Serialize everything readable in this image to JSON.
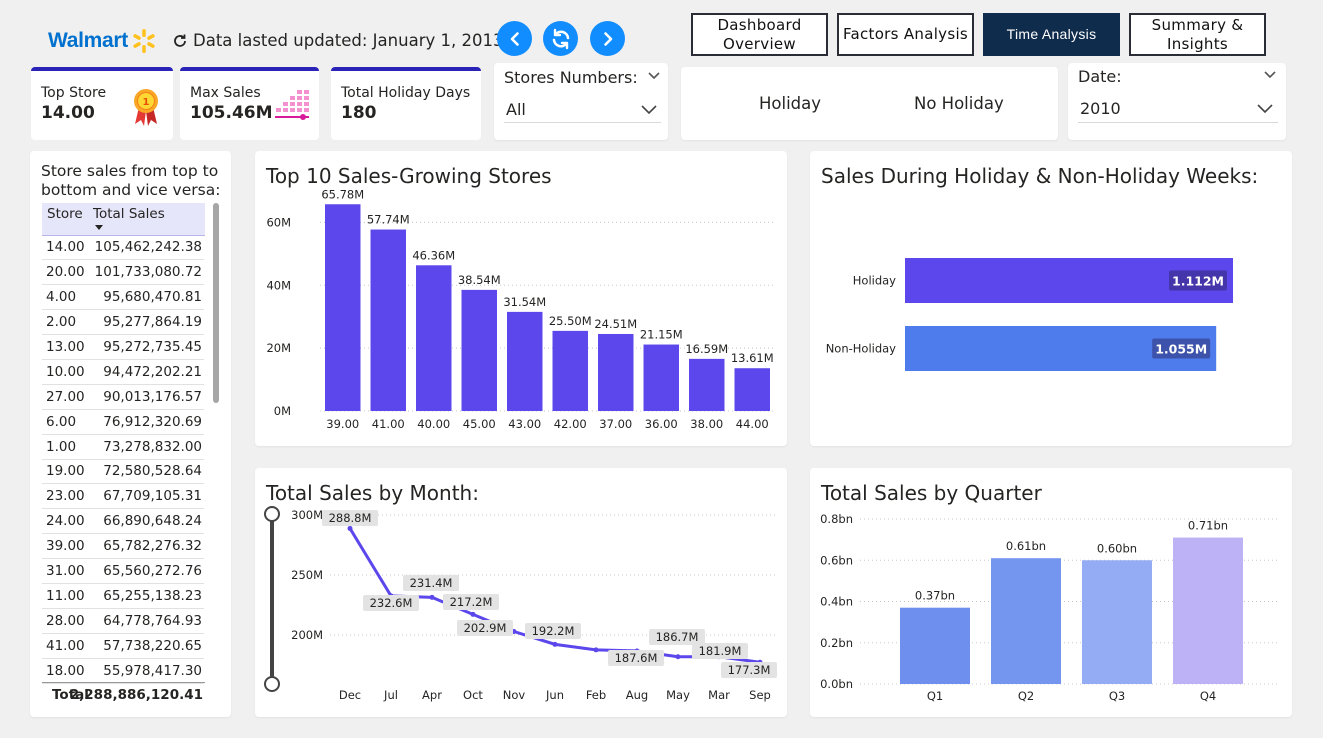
{
  "header": {
    "brand": "Walmart",
    "updated_text": "Data lasted updated: January 1, 2013",
    "tabs": [
      {
        "label_line1": "Dashboard",
        "label_line2": "Overview",
        "active": false
      },
      {
        "label_line1": "Factors Analysis",
        "label_line2": "",
        "active": false
      },
      {
        "label_line1": "Time Analysis",
        "label_line2": "",
        "active": true
      },
      {
        "label_line1": "Summary &",
        "label_line2": "Insights",
        "active": false
      }
    ],
    "icons": [
      "spark-logo-icon",
      "refresh-small-icon",
      "chevron-left-icon",
      "refresh-icon",
      "chevron-right-icon"
    ]
  },
  "kpis": {
    "top_store": {
      "label": "Top Store",
      "value": "14.00",
      "icon": "medal-icon"
    },
    "max_sales": {
      "label": "Max Sales",
      "value": "105.46M",
      "icon": "bar-levels-icon"
    },
    "holiday_days": {
      "label": "Total Holiday Days",
      "value": "180"
    }
  },
  "filters": {
    "stores": {
      "title": "Stores Numbers:",
      "value": "All"
    },
    "holiday_toggle": {
      "option1": "Holiday",
      "option2": "No Holiday"
    },
    "date": {
      "title": "Date:",
      "value": "2010"
    }
  },
  "store_table": {
    "title_line1": "Store sales from top to",
    "title_line2": "bottom and vice versa:",
    "col_store": "Store",
    "col_sales": "Total Sales",
    "rows": [
      [
        "14.00",
        "105,462,242.38"
      ],
      [
        "20.00",
        "101,733,080.72"
      ],
      [
        "4.00",
        "95,680,470.81"
      ],
      [
        "2.00",
        "95,277,864.19"
      ],
      [
        "13.00",
        "95,272,735.45"
      ],
      [
        "10.00",
        "94,472,202.21"
      ],
      [
        "27.00",
        "90,013,176.57"
      ],
      [
        "6.00",
        "76,912,320.69"
      ],
      [
        "1.00",
        "73,278,832.00"
      ],
      [
        "19.00",
        "72,580,528.64"
      ],
      [
        "23.00",
        "67,709,105.31"
      ],
      [
        "24.00",
        "66,890,648.24"
      ],
      [
        "39.00",
        "65,782,276.32"
      ],
      [
        "31.00",
        "65,560,272.76"
      ],
      [
        "11.00",
        "65,255,138.23"
      ],
      [
        "28.00",
        "64,778,764.93"
      ],
      [
        "41.00",
        "57,738,220.65"
      ],
      [
        "18.00",
        "55,978,417.30"
      ]
    ],
    "total_label": "Total",
    "total_value": "2,288,886,120.41"
  },
  "chart_data": [
    {
      "type": "bar",
      "title": "Top 10 Sales-Growing Stores",
      "categories": [
        "39.00",
        "41.00",
        "40.00",
        "45.00",
        "43.00",
        "42.00",
        "37.00",
        "36.00",
        "38.00",
        "44.00"
      ],
      "values": [
        65.78,
        57.74,
        46.36,
        38.54,
        31.54,
        25.5,
        24.51,
        21.15,
        16.59,
        13.61
      ],
      "data_labels": [
        "65.78M",
        "57.74M",
        "46.36M",
        "38.54M",
        "31.54M",
        "25.50M",
        "24.51M",
        "21.15M",
        "16.59M",
        "13.61M"
      ],
      "yticks": [
        "0M",
        "20M",
        "40M",
        "60M"
      ],
      "ylim": [
        0,
        70
      ],
      "color": "#5b47ec"
    },
    {
      "type": "bar",
      "orientation": "horizontal",
      "title": "Sales During Holiday & Non-Holiday Weeks:",
      "categories": [
        "Holiday",
        "Non-Holiday"
      ],
      "values": [
        1.112,
        1.055
      ],
      "data_labels": [
        "1.112M",
        "1.055M"
      ],
      "colors": [
        "#5b47ec",
        "#4f7cec"
      ]
    },
    {
      "type": "line",
      "title": "Total Sales by Month:",
      "categories": [
        "Dec",
        "Jul",
        "Apr",
        "Oct",
        "Nov",
        "Jun",
        "Feb",
        "Aug",
        "May",
        "Mar",
        "Sep"
      ],
      "values": [
        288.8,
        232.6,
        231.4,
        217.2,
        202.9,
        192.2,
        187.6,
        186.7,
        181.9,
        177.3
      ],
      "data_labels": [
        "288.8M",
        "232.6M",
        "231.4M",
        "217.2M",
        "202.9M",
        "192.2M",
        "187.6M",
        "186.7M",
        "181.9M",
        "177.3M"
      ],
      "yticks": [
        "200M",
        "250M",
        "300M"
      ],
      "ylim": [
        170,
        300
      ],
      "color": "#5b47ec"
    },
    {
      "type": "bar",
      "title": "Total Sales by Quarter",
      "categories": [
        "Q1",
        "Q2",
        "Q3",
        "Q4"
      ],
      "values": [
        0.37,
        0.61,
        0.6,
        0.71
      ],
      "data_labels": [
        "0.37bn",
        "0.61bn",
        "0.60bn",
        "0.71bn"
      ],
      "yticks": [
        "0.0bn",
        "0.2bn",
        "0.4bn",
        "0.6bn",
        "0.8bn"
      ],
      "ylim": [
        0,
        0.8
      ],
      "colors": [
        "#6f8fef",
        "#7596ef",
        "#94acf4",
        "#bdb2f6"
      ]
    }
  ]
}
